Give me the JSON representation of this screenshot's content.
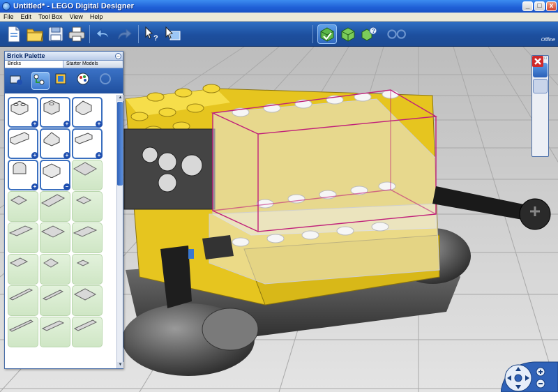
{
  "window": {
    "title": "Untitled* - LEGO Digital Designer",
    "min_label": "_",
    "max_label": "□",
    "close_label": "x"
  },
  "menu": {
    "items": [
      "File",
      "Edit",
      "Tool Box",
      "View",
      "Help"
    ]
  },
  "toolbar": {
    "status": "Offline",
    "buttons": [
      "new-document-icon",
      "open-folder-icon",
      "save-icon",
      "print-icon",
      "undo-icon",
      "redo-icon",
      "select-help-icon",
      "select-screen-icon",
      "build-mode-icon",
      "view-mode-icon",
      "building-guide-icon",
      "settings-icon"
    ]
  },
  "palette": {
    "title": "Brick Palette",
    "min_label": "–",
    "tabs": [
      "Bricks",
      "Starter Models"
    ],
    "active_tab": "Bricks",
    "categories": [
      "brick-add-icon",
      "technic-icon",
      "decoration-icon",
      "paint-icon",
      "disabled-icon"
    ]
  },
  "righttools": {
    "min_label": "□",
    "tools": [
      "select-icon",
      "clone-icon",
      "hinge-icon",
      "paint-bucket-icon",
      "delete-icon"
    ]
  },
  "colors": {
    "brick_yellow": "#f2d233",
    "accent_blue": "#1d4f9e",
    "selection": "#c0207a"
  }
}
